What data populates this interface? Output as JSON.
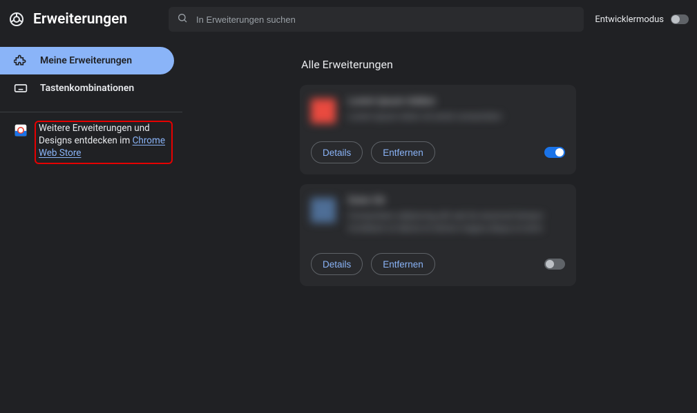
{
  "header": {
    "title": "Erweiterungen",
    "search_placeholder": "In Erweiterungen suchen",
    "dev_mode_label": "Entwicklermodus",
    "dev_mode_on": false
  },
  "sidebar": {
    "items": [
      {
        "id": "my-extensions",
        "label": "Meine Erweiterungen",
        "icon": "puzzle",
        "active": true
      },
      {
        "id": "shortcuts",
        "label": "Tastenkombinationen",
        "icon": "keyboard",
        "active": false
      }
    ],
    "footer": {
      "text_before": "Weitere Erweiterungen und Designs entdecken im ",
      "link_text": "Chrome Web Store",
      "highlighted": true
    }
  },
  "main": {
    "section_title": "Alle Erweiterungen",
    "details_label": "Details",
    "remove_label": "Entfernen",
    "extensions": [
      {
        "id": "ext1",
        "name": "Lorem Ipsum Addon",
        "description": "Lorem ipsum dolor sit amet consectetur",
        "icon_color": "red",
        "enabled": true,
        "blurred": true
      },
      {
        "id": "ext2",
        "name": "Dolor Sit",
        "description": "Consectetur adipiscing elit sed do eiusmod tempor incididunt ut labore et dolore magna aliqua ut enim",
        "icon_color": "blue",
        "enabled": false,
        "blurred": true
      }
    ]
  }
}
